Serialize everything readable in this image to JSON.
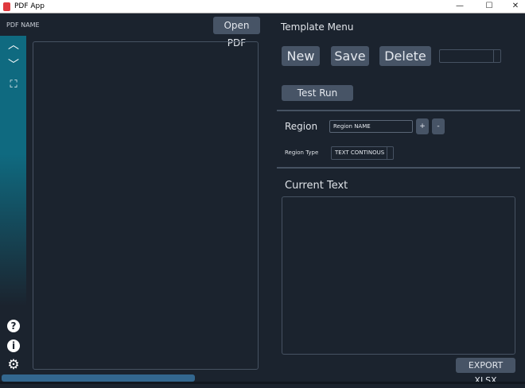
{
  "window": {
    "title": "PDF App",
    "minimize": "—",
    "maximize": "☐",
    "close": "✕"
  },
  "left": {
    "pdf_name": "PDF NAME",
    "open_pdf": "Open PDF"
  },
  "sidebar": {
    "icons": [
      "chevron-up-icon",
      "chevron-down-icon",
      "fullscreen-icon",
      "help-icon",
      "info-icon",
      "gear-icon"
    ],
    "accent": "#0f6a80"
  },
  "template": {
    "heading": "Template Menu",
    "new": "New",
    "save": "Save",
    "delete": "Delete",
    "template_select": "",
    "test_run": "Test Run"
  },
  "region": {
    "label": "Region",
    "name_value": "Region NAME",
    "add": "+",
    "remove": "-",
    "type_label": "Region Type",
    "type_value": "TEXT CONTINOUS"
  },
  "current_text": {
    "heading": "Current Text",
    "value": ""
  },
  "export": "EXPORT XLSX",
  "progress": {
    "percent": 37,
    "color": "#33678f"
  }
}
